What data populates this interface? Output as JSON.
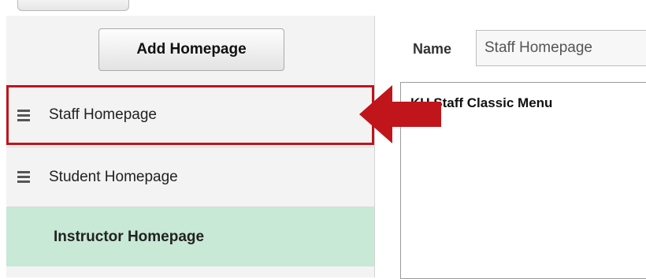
{
  "sidebar": {
    "add_button_label": "Add Homepage",
    "items": [
      {
        "label": "Staff Homepage",
        "icon": "drag-handle-icon",
        "state": "highlighted"
      },
      {
        "label": "Student Homepage",
        "icon": "drag-handle-icon",
        "state": "normal"
      },
      {
        "label": "Instructor Homepage",
        "icon": "",
        "state": "active"
      }
    ]
  },
  "detail": {
    "name_label": "Name",
    "name_value": "Staff Homepage",
    "menu_title": "KU Staff Classic Menu"
  },
  "colors": {
    "highlight_border": "#c0151a",
    "arrow": "#c0151a",
    "active_row": "#c7e9d6"
  }
}
